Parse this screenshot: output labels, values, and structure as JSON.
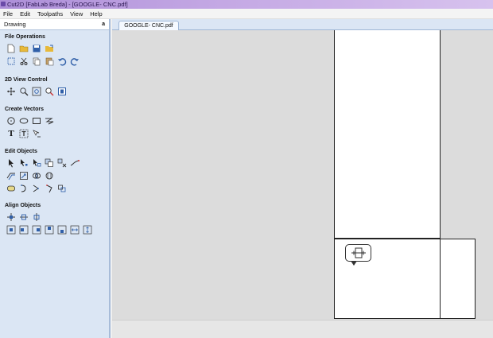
{
  "window": {
    "title": "Cut2D [FabLab Breda] - [GOOGLE- CNC.pdf]"
  },
  "menu": [
    "File",
    "Edit",
    "Toolpaths",
    "View",
    "Help"
  ],
  "sidebar": {
    "header": "Drawing",
    "pin": "a",
    "sections": {
      "file_ops": "File Operations",
      "view_control": "2D View Control",
      "create_vectors": "Create Vectors",
      "edit_objects": "Edit Objects",
      "align_objects": "Align Objects"
    },
    "text_tool_glyph": "T"
  },
  "tabs": {
    "document": "GOOGLE- CNC.pdf"
  },
  "colors": {
    "sidebar_bg": "#dbe6f4",
    "canvas_bg": "#dcdcdc",
    "icon_blue": "#2f5fa8",
    "icon_yellow": "#e7b93a",
    "icon_purple": "#5b3c9a"
  }
}
